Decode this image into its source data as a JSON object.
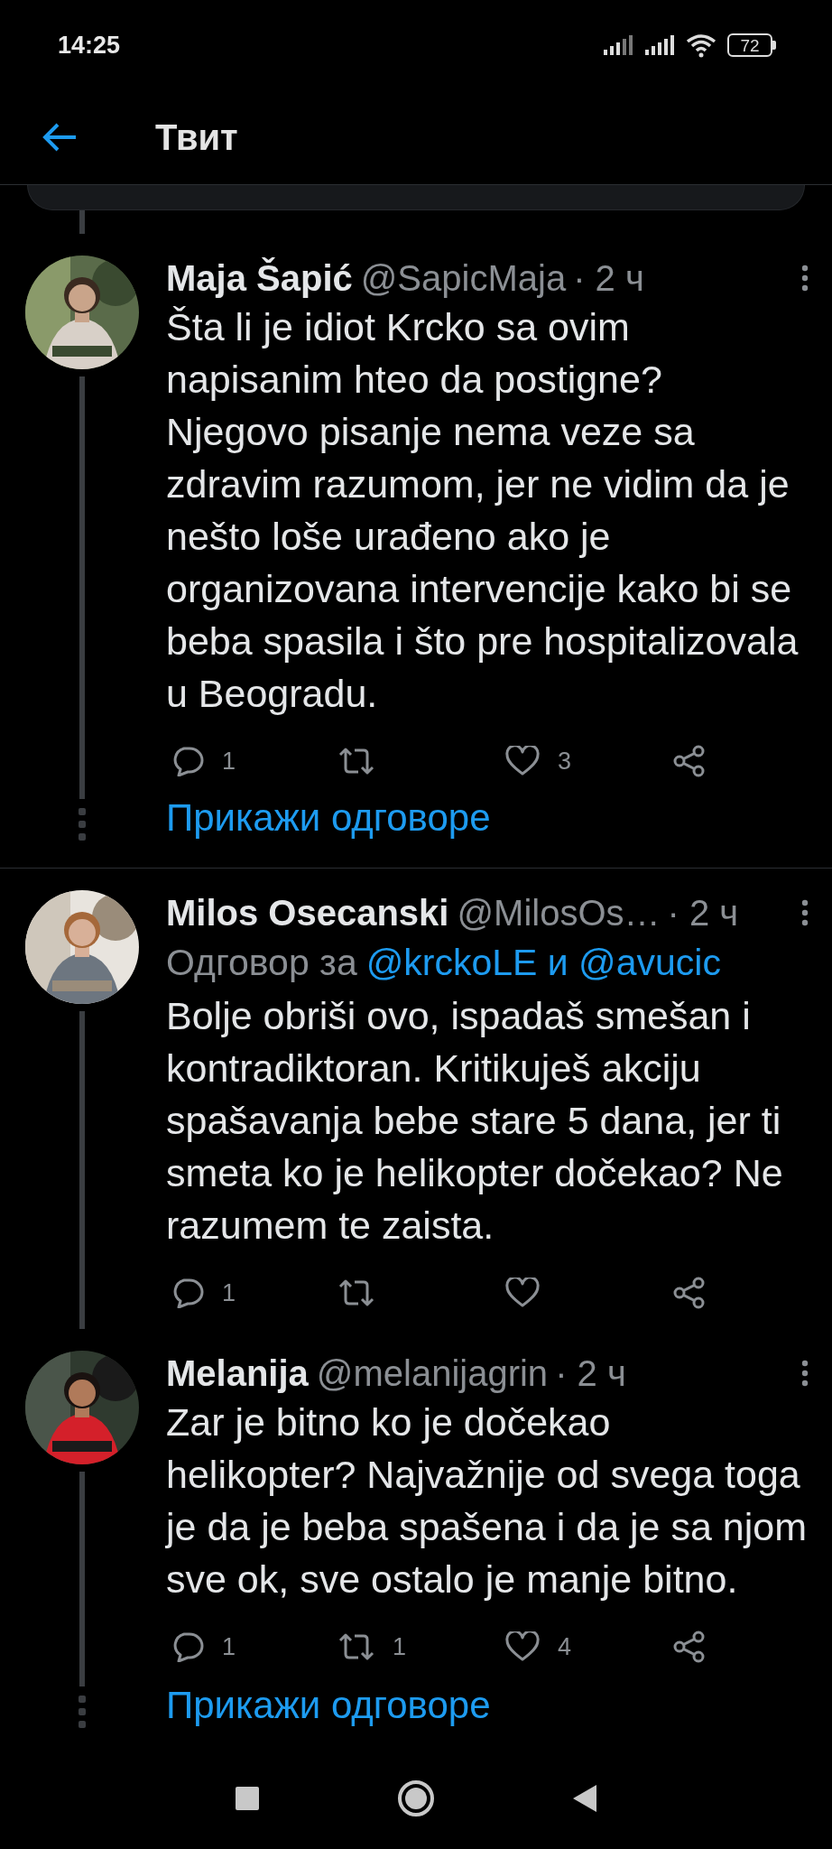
{
  "status_bar": {
    "time": "14:25",
    "battery": "72"
  },
  "header": {
    "title": "Твит"
  },
  "tweets": [
    {
      "name": "Maja Šapić",
      "handle": "@SapicMaja",
      "time": "· 2 ч",
      "body": "Šta li je idiot Krcko sa ovim napisanim hteo da postigne? Njegovo pisanje nema veze sa zdravim razumom, jer ne vidim da je nešto loše urađeno ako je organizovana intervencije kako bi se beba spasila i što pre hospitalizovala u Beogradu.",
      "replies": "1",
      "likes": "3",
      "show_replies": "Прикажи одговоре"
    },
    {
      "name": "Milos Osecanski",
      "handle": "@MilosOs…",
      "time": "· 2 ч",
      "reply_to": {
        "prefix": "Одговор за",
        "mentions": "@krckoLE и @avucic"
      },
      "body": "Bolje obriši ovo, ispadaš smešan i kontradiktoran. Kritikuješ akciju spašavanja bebe stare 5 dana, jer ti smeta ko je helikopter dočekao? Ne razumem te zaista.",
      "replies": "1"
    },
    {
      "name": "Melanija",
      "handle": "@melanijagrin",
      "time": "· 2 ч",
      "body": "Zar je bitno ko je dočekao helikopter? Najvažnije od svega toga je da je beba spašena i da je sa njom sve ok, sve ostalo je manje bitno.",
      "replies": "1",
      "retweets": "1",
      "likes": "4",
      "show_replies": "Прикажи одговоре"
    }
  ]
}
